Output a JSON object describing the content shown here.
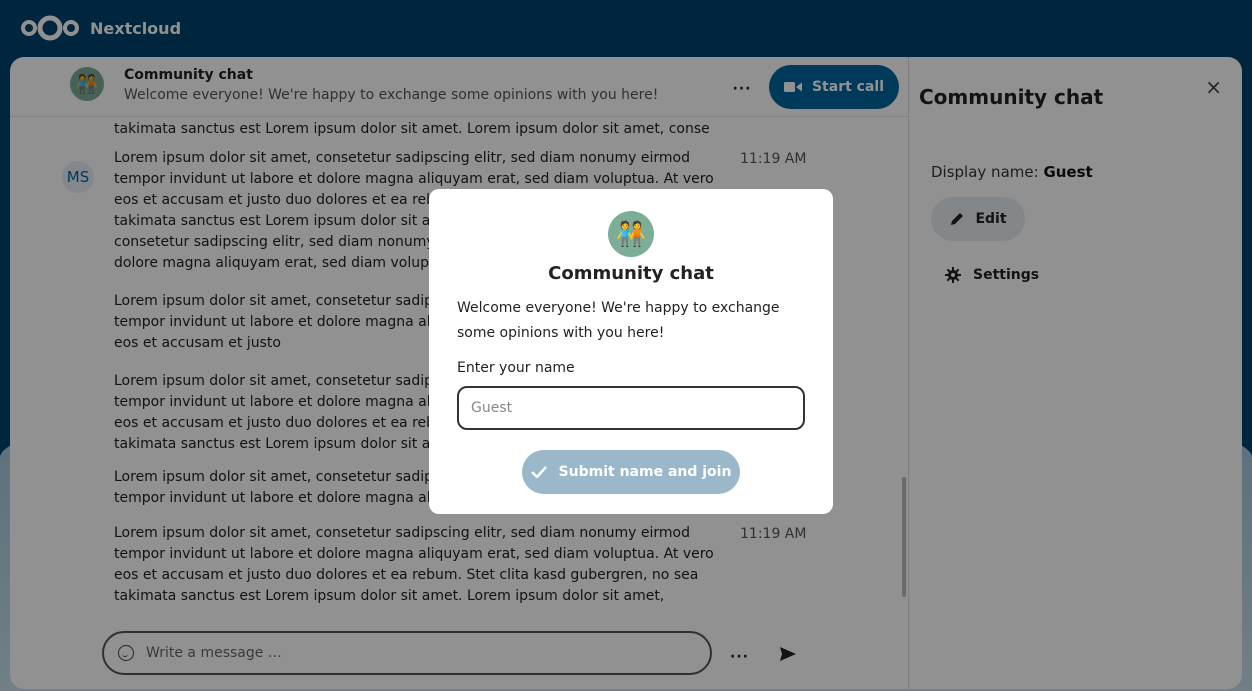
{
  "app": {
    "brand": "Nextcloud"
  },
  "conversation": {
    "title": "Community chat",
    "description": "Welcome everyone! We're happy to exchange some opinions with you here!",
    "avatar_emoji": "🧑‍🤝‍🧑",
    "more_label": "···",
    "start_call_label": "Start call"
  },
  "messages": [
    {
      "text": "takimata sanctus est Lorem ipsum dolor sit amet. Lorem ipsum dolor sit amet, conse",
      "time": ""
    },
    {
      "author": "MS",
      "text": "Lorem ipsum dolor sit amet, consetetur sadipscing elitr, sed diam nonumy eirmod tempor invidunt ut labore et dolore magna aliquyam erat, sed diam voluptua. At vero eos et accusam et justo duo dolores et ea rebum. Stet clita kasd gubergren, no sea takimata sanctus est Lorem ipsum dolor sit amet. Lorem ipsum dolor sit amet, consetetur sadipscing elitr, sed diam nonumy eirmod tempor invidunt ut labore et dolore magna aliquyam erat, sed diam voluptua.",
      "time": "11:19 AM"
    },
    {
      "text": "Lorem ipsum dolor sit amet, consetetur sadipscing elitr, sed diam nonumy eirmod tempor invidunt ut labore et dolore magna aliquyam erat, sed diam voluptua. At vero eos et accusam et justo",
      "time": ""
    },
    {
      "text": "Lorem ipsum dolor sit amet, consetetur sadipscing elitr, sed diam nonumy eirmod tempor invidunt ut labore et dolore magna aliquyam erat, sed diam voluptua. At vero eos et accusam et justo duo dolores et ea rebum. Stet clita kasd gubergren, no sea takimata sanctus est Lorem ipsum dolor sit amet.",
      "time": ""
    },
    {
      "text": "Lorem ipsum dolor sit amet, consetetur sadipscing elitr, sed diam nonumy eirmod tempor invidunt ut labore et dolore magna aliquyam erat.",
      "time": ""
    },
    {
      "text": "Lorem ipsum dolor sit amet, consetetur sadipscing elitr, sed diam nonumy eirmod tempor invidunt ut labore et dolore magna aliquyam erat, sed diam voluptua. At vero eos et accusam et justo duo dolores et ea rebum. Stet clita kasd gubergren, no sea takimata sanctus est Lorem ipsum dolor sit amet. Lorem ipsum dolor sit amet,",
      "time": "11:19 AM"
    }
  ],
  "composer": {
    "placeholder": "Write a message …",
    "more_label": "···"
  },
  "sidebar": {
    "title": "Community chat",
    "close_label": "×",
    "display_name_label": "Display name:",
    "display_name_value": "Guest",
    "edit_label": "Edit",
    "settings_label": "Settings"
  },
  "modal": {
    "title": "Community chat",
    "description": "Welcome everyone! We're happy to exchange some opinions with you here!",
    "name_label": "Enter your name",
    "name_placeholder": "Guest",
    "submit_label": "Submit name and join"
  },
  "colors": {
    "header_bg": "#00426e",
    "primary": "#00679e",
    "submit_disabled": "#9ab8ca"
  }
}
